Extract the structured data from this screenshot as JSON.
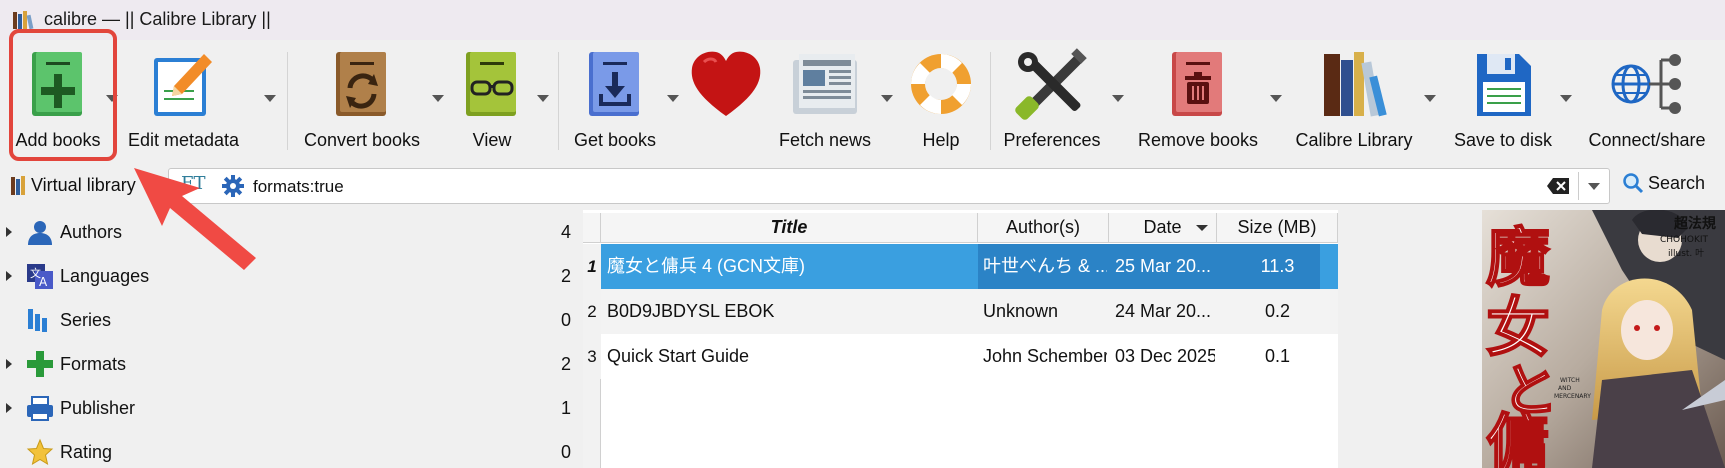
{
  "window": {
    "title": "calibre — || Calibre Library ||"
  },
  "toolbar": {
    "add_books": "Add books",
    "edit_metadata": "Edit metadata",
    "convert_books": "Convert books",
    "view": "View",
    "get_books": "Get books",
    "fetch_news": "Fetch news",
    "help": "Help",
    "preferences": "Preferences",
    "remove_books": "Remove books",
    "calibre_library": "Calibre Library",
    "save_to_disk": "Save to disk",
    "connect_share": "Connect/share"
  },
  "searchbar": {
    "virtual_library": "Virtual library",
    "ft_label": "FT",
    "query": "formats:true",
    "search_label": "Search"
  },
  "tag_browser": {
    "items": [
      {
        "label": "Authors",
        "count": "4",
        "icon": "user-icon"
      },
      {
        "label": "Languages",
        "count": "2",
        "icon": "language-icon"
      },
      {
        "label": "Series",
        "count": "0",
        "icon": "series-icon"
      },
      {
        "label": "Formats",
        "count": "2",
        "icon": "plus-icon"
      },
      {
        "label": "Publisher",
        "count": "1",
        "icon": "publisher-icon"
      },
      {
        "label": "Rating",
        "count": "0",
        "icon": "star-icon"
      }
    ]
  },
  "book_table": {
    "columns": [
      "Title",
      "Author(s)",
      "Date",
      "Size (MB)"
    ],
    "rows": [
      {
        "num": "1",
        "title": "魔女と傭兵 4 (GCN文庫)",
        "authors": "叶世べんち & ...",
        "date": "25 Mar 20...",
        "size": "11.3"
      },
      {
        "num": "2",
        "title": "B0D9JBDYSL EBOK",
        "authors": "Unknown",
        "date": "24 Mar 20...",
        "size": "0.2"
      },
      {
        "num": "3",
        "title": "Quick Start Guide",
        "authors": "John Schember",
        "date": "03 Dec 2025",
        "size": "0.1"
      }
    ]
  },
  "cover": {
    "big_title": "魔女と傭",
    "top_text": "超法規",
    "artist": "CHOHOKIT",
    "illust": "illust. 叶",
    "subtitle": "WITCH AND MERCENARY"
  },
  "colors": {
    "selection": "#3a9fe0",
    "highlight": "#e2453c"
  }
}
